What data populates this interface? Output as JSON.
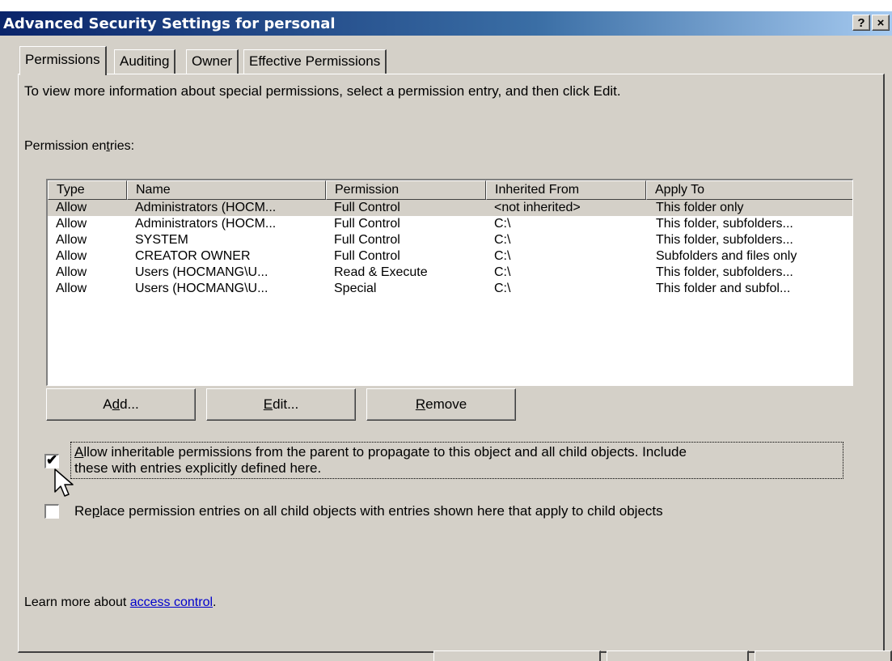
{
  "window": {
    "title": "Advanced Security Settings for personal",
    "help_button": "?",
    "close_button": "×"
  },
  "tabs": [
    {
      "label": "Permissions",
      "active": true
    },
    {
      "label": "Auditing",
      "active": false
    },
    {
      "label": "Owner",
      "active": false
    },
    {
      "label": "Effective Permissions",
      "active": false
    }
  ],
  "permissions": {
    "info_text": "To view more information about special permissions, select a permission entry, and then click Edit.",
    "entries_label_pre": "Permission en",
    "entries_label_mnemonic": "t",
    "entries_label_post": "ries:",
    "columns": [
      "Type",
      "Name",
      "Permission",
      "Inherited From",
      "Apply To"
    ],
    "rows": [
      [
        "Allow",
        "Administrators (HOCM...",
        "Full Control",
        "<not inherited>",
        "This folder only"
      ],
      [
        "Allow",
        "Administrators (HOCM...",
        "Full Control",
        "C:\\",
        "This folder, subfolders..."
      ],
      [
        "Allow",
        "SYSTEM",
        "Full Control",
        "C:\\",
        "This folder, subfolders..."
      ],
      [
        "Allow",
        "CREATOR OWNER",
        "Full Control",
        "C:\\",
        "Subfolders and files only"
      ],
      [
        "Allow",
        "Users (HOCMANG\\U...",
        "Read & Execute",
        "C:\\",
        "This folder, subfolders..."
      ],
      [
        "Allow",
        "Users (HOCMANG\\U...",
        "Special",
        "C:\\",
        "This folder and subfol..."
      ]
    ],
    "buttons": {
      "add": {
        "pre": "A",
        "mnemonic": "d",
        "post": "d..."
      },
      "edit": {
        "pre": "",
        "mnemonic": "E",
        "post": "dit..."
      },
      "remove": {
        "pre": "",
        "mnemonic": "R",
        "post": "emove"
      }
    },
    "inherit_checkbox": {
      "checked": true,
      "line1_mnemonic": "A",
      "line1_rest": "llow inheritable permissions from the parent to propagate to this object and all child objects. Include",
      "line2": "these with entries explicitly defined here."
    },
    "replace_checkbox": {
      "checked": false,
      "pre": "Re",
      "mnemonic": "p",
      "post": "lace permission entries on all child objects with entries shown here that apply to child objects"
    },
    "learn_more_prefix": "Learn more about ",
    "learn_more_link": "access control",
    "learn_more_suffix": "."
  }
}
